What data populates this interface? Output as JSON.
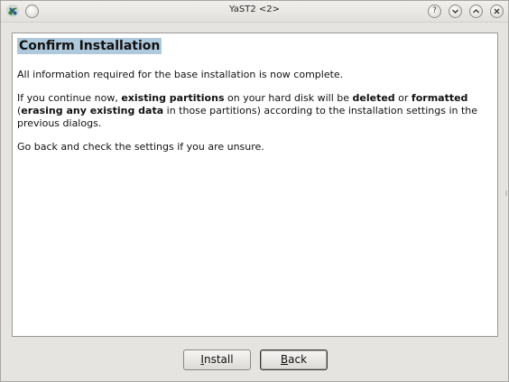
{
  "window": {
    "title": "YaST2 <2>",
    "app_icon": "yast-icon",
    "menu_button": "circle-menu-icon",
    "controls": [
      {
        "name": "help-button",
        "icon": "question-icon",
        "glyph": "?"
      },
      {
        "name": "minimize-button",
        "icon": "chevron-down-icon",
        "glyph": "⌄"
      },
      {
        "name": "maximize-button",
        "icon": "chevron-up-icon",
        "glyph": "⌃"
      },
      {
        "name": "close-button",
        "icon": "close-icon",
        "glyph": "✕"
      }
    ]
  },
  "dialog": {
    "heading": "Confirm Installation",
    "paragraph1": "All information required for the base installation is now complete.",
    "paragraph2": {
      "t1": "If you continue now, ",
      "b1": "existing partitions",
      "t2": " on your hard disk will be ",
      "b2": "deleted",
      "t3": " or ",
      "b3": "formatted",
      "t4": " (",
      "b4": "erasing any existing data",
      "t5": " in those partitions) according to the installation settings in the previous dialogs."
    },
    "paragraph3": "Go back and check the settings if you are unsure."
  },
  "buttons": {
    "install": {
      "mnemonic": "I",
      "rest": "nstall"
    },
    "back": {
      "mnemonic": "B",
      "rest": "ack"
    }
  },
  "colors": {
    "heading_highlight": "#aec8dc",
    "window_bg": "#e6e4e0",
    "content_bg": "#ffffff"
  }
}
